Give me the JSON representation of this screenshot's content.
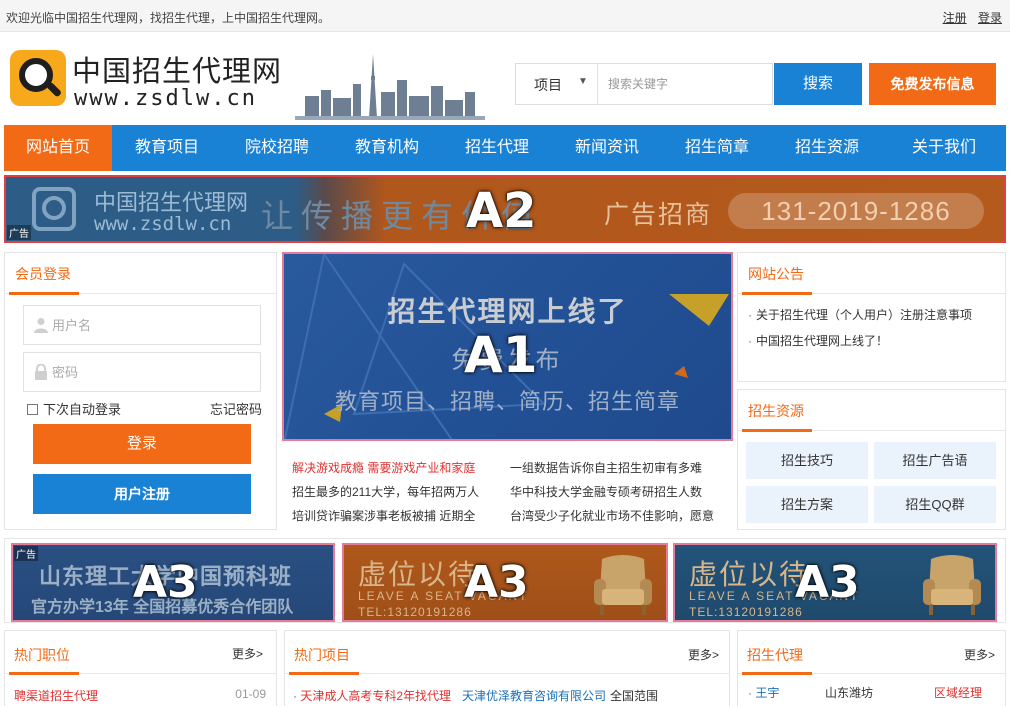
{
  "topbar": {
    "welcome": "欢迎光临中国招生代理网，找招生代理，上中国招生代理网。",
    "register": "注册",
    "login": "登录"
  },
  "header": {
    "logo_cn": "中国招生代理网",
    "logo_url": "www.zsdlw.cn",
    "search_select": "项目",
    "search_placeholder": "搜索关键字",
    "search_button": "搜索",
    "post_button": "免费发布信息"
  },
  "nav": [
    "网站首页",
    "教育项目",
    "院校招聘",
    "教育机构",
    "招生代理",
    "新闻资讯",
    "招生简章",
    "招生资源",
    "关于我们"
  ],
  "banner_a2": {
    "slot": "A2",
    "brand_cn": "中国招生代理网",
    "brand_url": "www.zsdlw.cn",
    "slogan": "让传播更有价值",
    "ad_text": "广告招商",
    "phone": "131-2019-1286",
    "tag": "广告"
  },
  "login": {
    "title": "会员登录",
    "username_placeholder": "用户名",
    "password_placeholder": "密码",
    "remember": "下次自动登录",
    "forgot": "忘记密码",
    "login_button": "登录",
    "register_button": "用户注册"
  },
  "slider_a1": {
    "slot": "A1",
    "title": "招生代理网上线了",
    "free": "免费发布",
    "subtitle": "教育项目、招聘、简历、招生简章"
  },
  "news": [
    {
      "text": "解决游戏成瘾 需要游戏产业和家庭",
      "highlight": true
    },
    {
      "text": "一组数据告诉你自主招生初审有多难",
      "highlight": false
    },
    {
      "text": "招生最多的211大学，每年招两万人",
      "highlight": false
    },
    {
      "text": "华中科技大学金融专硕考研招生人数",
      "highlight": false
    },
    {
      "text": "培训贷诈骗案涉事老板被捕 近期全",
      "highlight": false
    },
    {
      "text": "台湾受少子化就业市场不佳影响，愿意",
      "highlight": false
    }
  ],
  "notice": {
    "title": "网站公告",
    "items": [
      "关于招生代理（个人用户）注册注意事项",
      "中国招生代理网上线了！"
    ]
  },
  "resources": {
    "title": "招生资源",
    "items": [
      "招生技巧",
      "招生广告语",
      "招生方案",
      "招生QQ群"
    ]
  },
  "banners_a3": [
    {
      "slot": "A3",
      "line1": "山东理工大学中国预科班",
      "line2": "官方办学13年 全国招募优秀合作团队",
      "tag": "广告"
    },
    {
      "slot": "A3",
      "line1": "虚位以待",
      "line2": "LEAVE A SEAT VACANT",
      "line3": "TEL:13120191286"
    },
    {
      "slot": "A3",
      "line1": "虚位以待",
      "line2": "LEAVE A SEAT VACANT",
      "line3": "TEL:13120191286"
    }
  ],
  "bottom": {
    "jobs": {
      "title": "热门职位",
      "more": "更多>",
      "first_item": "聘渠道招生代理",
      "first_date": "01-09"
    },
    "projects": {
      "title": "热门项目",
      "more": "更多>",
      "first_item": "天津成人高考专科2年找代理",
      "first_org": "天津优泽教育咨询有限公司",
      "first_scope": "全国范围"
    },
    "agents": {
      "title": "招生代理",
      "more": "更多>",
      "first_name": "王宇",
      "first_city": "山东潍坊",
      "first_role": "区域经理"
    }
  },
  "colors": {
    "brand_blue": "#1a82d4",
    "brand_orange": "#f26a16",
    "news_highlight": "#e03030",
    "link_blue": "#1a6fb8"
  }
}
